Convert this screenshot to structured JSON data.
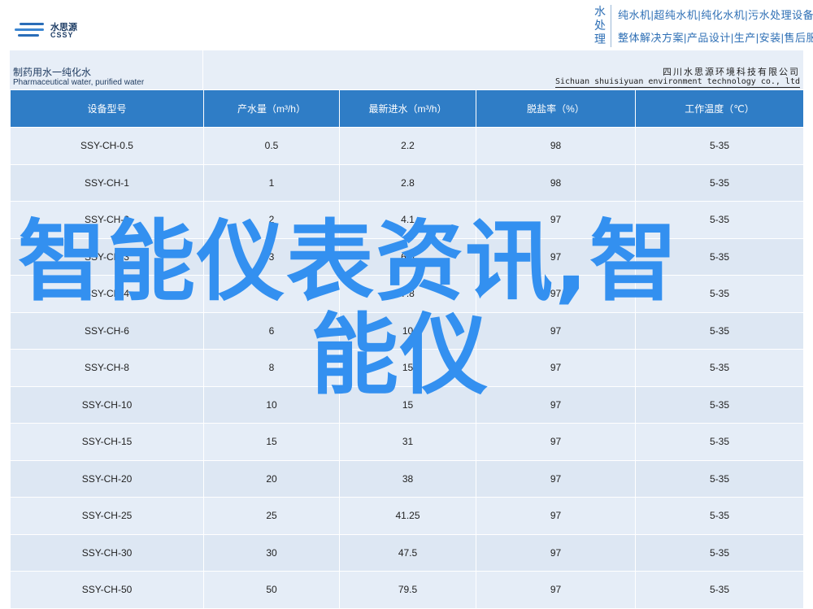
{
  "brand": {
    "logo_cn": "水思源",
    "logo_en": "CSSY"
  },
  "services": {
    "title": "水处理",
    "line1": "纯水机|超纯水机|纯化水机|污水处理设备",
    "line2": "整体解决方案|产品设计|生产|安装|售后服务"
  },
  "sheet": {
    "title_cn": "制药用水一纯化水",
    "title_en": "Pharmaceutical water, purified water",
    "company_cn": "四川水思源环境科技有限公司",
    "company_en": "Sichuan shuisiyuan environment technology co., ltd"
  },
  "table": {
    "headers": [
      "设备型号",
      "产水量（m³/h）",
      "最新进水（m³/h）",
      "脱盐率（%）",
      "工作温度（℃）"
    ],
    "rows": [
      [
        "SSY-CH-0.5",
        "0.5",
        "2.2",
        "98",
        "5-35"
      ],
      [
        "SSY-CH-1",
        "1",
        "2.8",
        "98",
        "5-35"
      ],
      [
        "SSY-CH-2",
        "2",
        "4.1",
        "97",
        "5-35"
      ],
      [
        "SSY-CH-3",
        "3",
        "6.5",
        "97",
        "5-35"
      ],
      [
        "SSY-CH-4",
        "4",
        "7.8",
        "97",
        "5-35"
      ],
      [
        "SSY-CH-6",
        "6",
        "10",
        "97",
        "5-35"
      ],
      [
        "SSY-CH-8",
        "8",
        "15",
        "97",
        "5-35"
      ],
      [
        "SSY-CH-10",
        "10",
        "15",
        "97",
        "5-35"
      ],
      [
        "SSY-CH-15",
        "15",
        "31",
        "97",
        "5-35"
      ],
      [
        "SSY-CH-20",
        "20",
        "38",
        "97",
        "5-35"
      ],
      [
        "SSY-CH-25",
        "25",
        "41.25",
        "97",
        "5-35"
      ],
      [
        "SSY-CH-30",
        "30",
        "47.5",
        "97",
        "5-35"
      ],
      [
        "SSY-CH-50",
        "50",
        "79.5",
        "97",
        "5-35"
      ]
    ]
  },
  "overlay": {
    "line1": "智能仪表资讯,智",
    "line2": "能仪",
    "color": "#3390f0"
  },
  "colors": {
    "header_blue": "#2f7dc6",
    "row_light": "#e5edf7",
    "row_dark": "#dde7f3",
    "brand_text": "#2e6fb5"
  }
}
